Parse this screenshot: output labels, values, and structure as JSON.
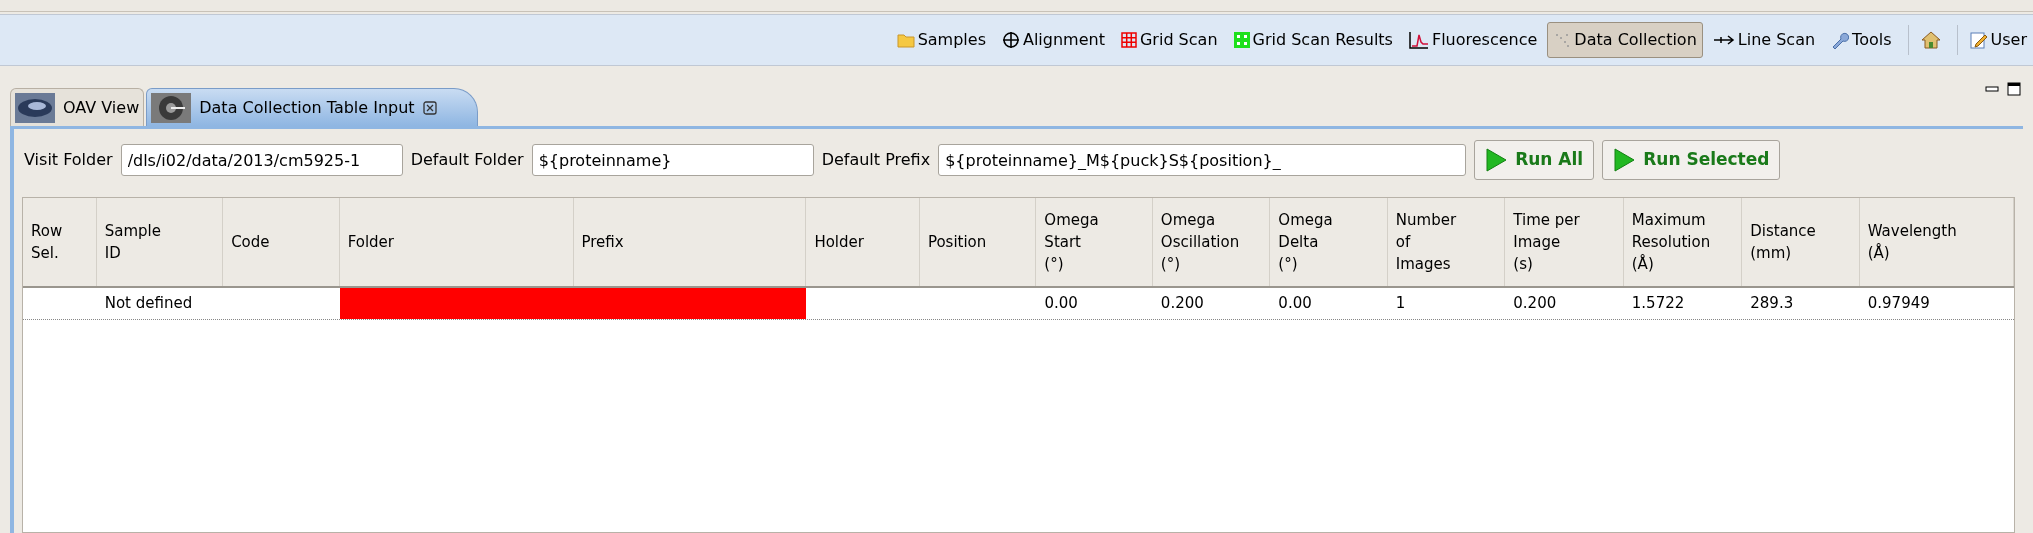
{
  "toolbar": {
    "items": [
      {
        "label": "Samples",
        "kind": "folder",
        "selected": false
      },
      {
        "label": "Alignment",
        "kind": "crosshair",
        "selected": false
      },
      {
        "label": "Grid Scan",
        "kind": "grid",
        "selected": false
      },
      {
        "label": "Grid Scan Results",
        "kind": "grid-results",
        "selected": false
      },
      {
        "label": "Fluorescence",
        "kind": "spectrum",
        "selected": false
      },
      {
        "label": "Data Collection",
        "kind": "dots",
        "selected": true
      },
      {
        "label": "Line Scan",
        "kind": "arrow",
        "selected": false
      },
      {
        "label": "Tools",
        "kind": "wrench",
        "selected": false
      },
      {
        "kind": "home",
        "selected": false
      },
      {
        "label": "User",
        "kind": "edit",
        "selected": false
      }
    ]
  },
  "tabs": [
    {
      "label": "OAV View",
      "selected": false
    },
    {
      "label": "Data Collection Table Input",
      "selected": true
    }
  ],
  "form": {
    "fields": [
      {
        "label": "Visit Folder",
        "value": "/dls/i02/data/2013/cm5925-1"
      },
      {
        "label": "Default Folder",
        "value": "${proteinname}"
      },
      {
        "label": "Default Prefix",
        "value": "${proteinname}_M${puck}S${position}_"
      }
    ],
    "buttons": [
      "Run All",
      "Run Selected"
    ]
  },
  "table": {
    "columns": [
      "Row\nSel.",
      "Sample\nID",
      "Code",
      "Folder",
      "Prefix",
      "Holder",
      "Position",
      "Omega\nStart\n(°)",
      "Omega\nOscillation\n(°)",
      "Omega\nDelta\n(°)",
      "Number\nof\nImages",
      "Time per\nImage\n(s)",
      "Maximum\nResolution\n(Å)",
      "Distance\n(mm)",
      "Wavelength\n(Å)"
    ],
    "rows": [
      {
        "cells": [
          {
            "invalid": false
          },
          {
            "text": "Not defined",
            "invalid": false
          },
          {
            "invalid": false
          },
          {
            "invalid": true
          },
          {
            "invalid": true
          },
          {
            "invalid": false
          },
          {
            "invalid": false
          },
          {
            "text": "0.00",
            "invalid": false
          },
          {
            "text": "0.200",
            "invalid": false
          },
          {
            "text": "0.00",
            "invalid": false
          },
          {
            "text": "1",
            "invalid": false
          },
          {
            "text": "0.200",
            "invalid": false
          },
          {
            "text": "1.5722",
            "invalid": false
          },
          {
            "text": "289.3",
            "invalid": false
          },
          {
            "text": "0.97949",
            "invalid": false
          }
        ]
      }
    ]
  }
}
